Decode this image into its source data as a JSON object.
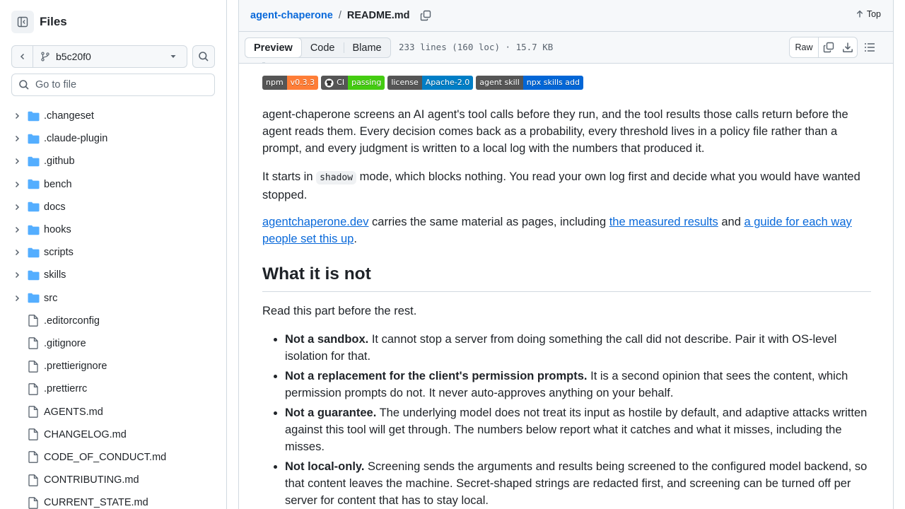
{
  "sidebar": {
    "title": "Files",
    "branch": "b5c20f0",
    "goto_placeholder": "Go to file",
    "tree": [
      {
        "name": ".changeset",
        "type": "folder"
      },
      {
        "name": ".claude-plugin",
        "type": "folder"
      },
      {
        "name": ".github",
        "type": "folder"
      },
      {
        "name": "bench",
        "type": "folder"
      },
      {
        "name": "docs",
        "type": "folder"
      },
      {
        "name": "hooks",
        "type": "folder"
      },
      {
        "name": "scripts",
        "type": "folder"
      },
      {
        "name": "skills",
        "type": "folder"
      },
      {
        "name": "src",
        "type": "folder"
      },
      {
        "name": ".editorconfig",
        "type": "file"
      },
      {
        "name": ".gitignore",
        "type": "file"
      },
      {
        "name": ".prettierignore",
        "type": "file"
      },
      {
        "name": ".prettierrc",
        "type": "file"
      },
      {
        "name": "AGENTS.md",
        "type": "file"
      },
      {
        "name": "CHANGELOG.md",
        "type": "file"
      },
      {
        "name": "CODE_OF_CONDUCT.md",
        "type": "file"
      },
      {
        "name": "CONTRIBUTING.md",
        "type": "file"
      },
      {
        "name": "CURRENT_STATE.md",
        "type": "file"
      }
    ]
  },
  "header": {
    "repo": "agent-chaperone",
    "separator": "/",
    "file": "README.md",
    "top_label": "Top"
  },
  "toolbar": {
    "tabs": [
      "Preview",
      "Code",
      "Blame"
    ],
    "active_tab": "Preview",
    "meta": "233 lines (160 loc) · 15.7 KB",
    "raw_label": "Raw"
  },
  "badges": [
    {
      "label": "npm",
      "value": "v0.3.3",
      "color": "#fe7d37"
    },
    {
      "label": "CI",
      "value": "passing",
      "color": "#4c1",
      "icon": "github-icon"
    },
    {
      "label": "license",
      "value": "Apache-2.0",
      "color": "#007ec6"
    },
    {
      "label": "agent skill",
      "value": "npx skills add",
      "color": "#0366d6"
    }
  ],
  "readme": {
    "p1": "agent-chaperone screens an AI agent's tool calls before they run, and the tool results those calls return before the agent reads them. Every decision comes back as a probability, every threshold lives in a policy file rather than a prompt, and every judgment is written to a local log with the numbers that produced it.",
    "p2_a": "It starts in ",
    "p2_code": "shadow",
    "p2_b": " mode, which blocks nothing. You read your own log first and decide what you would have wanted stopped.",
    "p3_link1": "agentchaperone.dev",
    "p3_a": " carries the same material as pages, including ",
    "p3_link2": "the measured results",
    "p3_b": " and ",
    "p3_link3": "a guide for each way people set this up",
    "p3_c": ".",
    "h2": "What it is not",
    "p4": "Read this part before the rest.",
    "bullets": [
      {
        "bold": "Not a sandbox.",
        "text": " It cannot stop a server from doing something the call did not describe. Pair it with OS-level isolation for that."
      },
      {
        "bold": "Not a replacement for the client's permission prompts.",
        "text": " It is a second opinion that sees the content, which permission prompts do not. It never auto-approves anything on your behalf."
      },
      {
        "bold": "Not a guarantee.",
        "text": " The underlying model does not treat its input as hostile by default, and adaptive attacks written against this tool will get through. The numbers below report what it catches and what it misses, including the misses."
      },
      {
        "bold": "Not local-only.",
        "text": " Screening sends the arguments and results being screened to the configured model backend, so that content leaves the machine. Secret-shaped strings are redacted first, and screening can be turned off per server for content that has to stay local."
      }
    ]
  },
  "colors": {
    "link": "#0969da",
    "folder": "#54aeff",
    "border": "#d1d9e0"
  }
}
